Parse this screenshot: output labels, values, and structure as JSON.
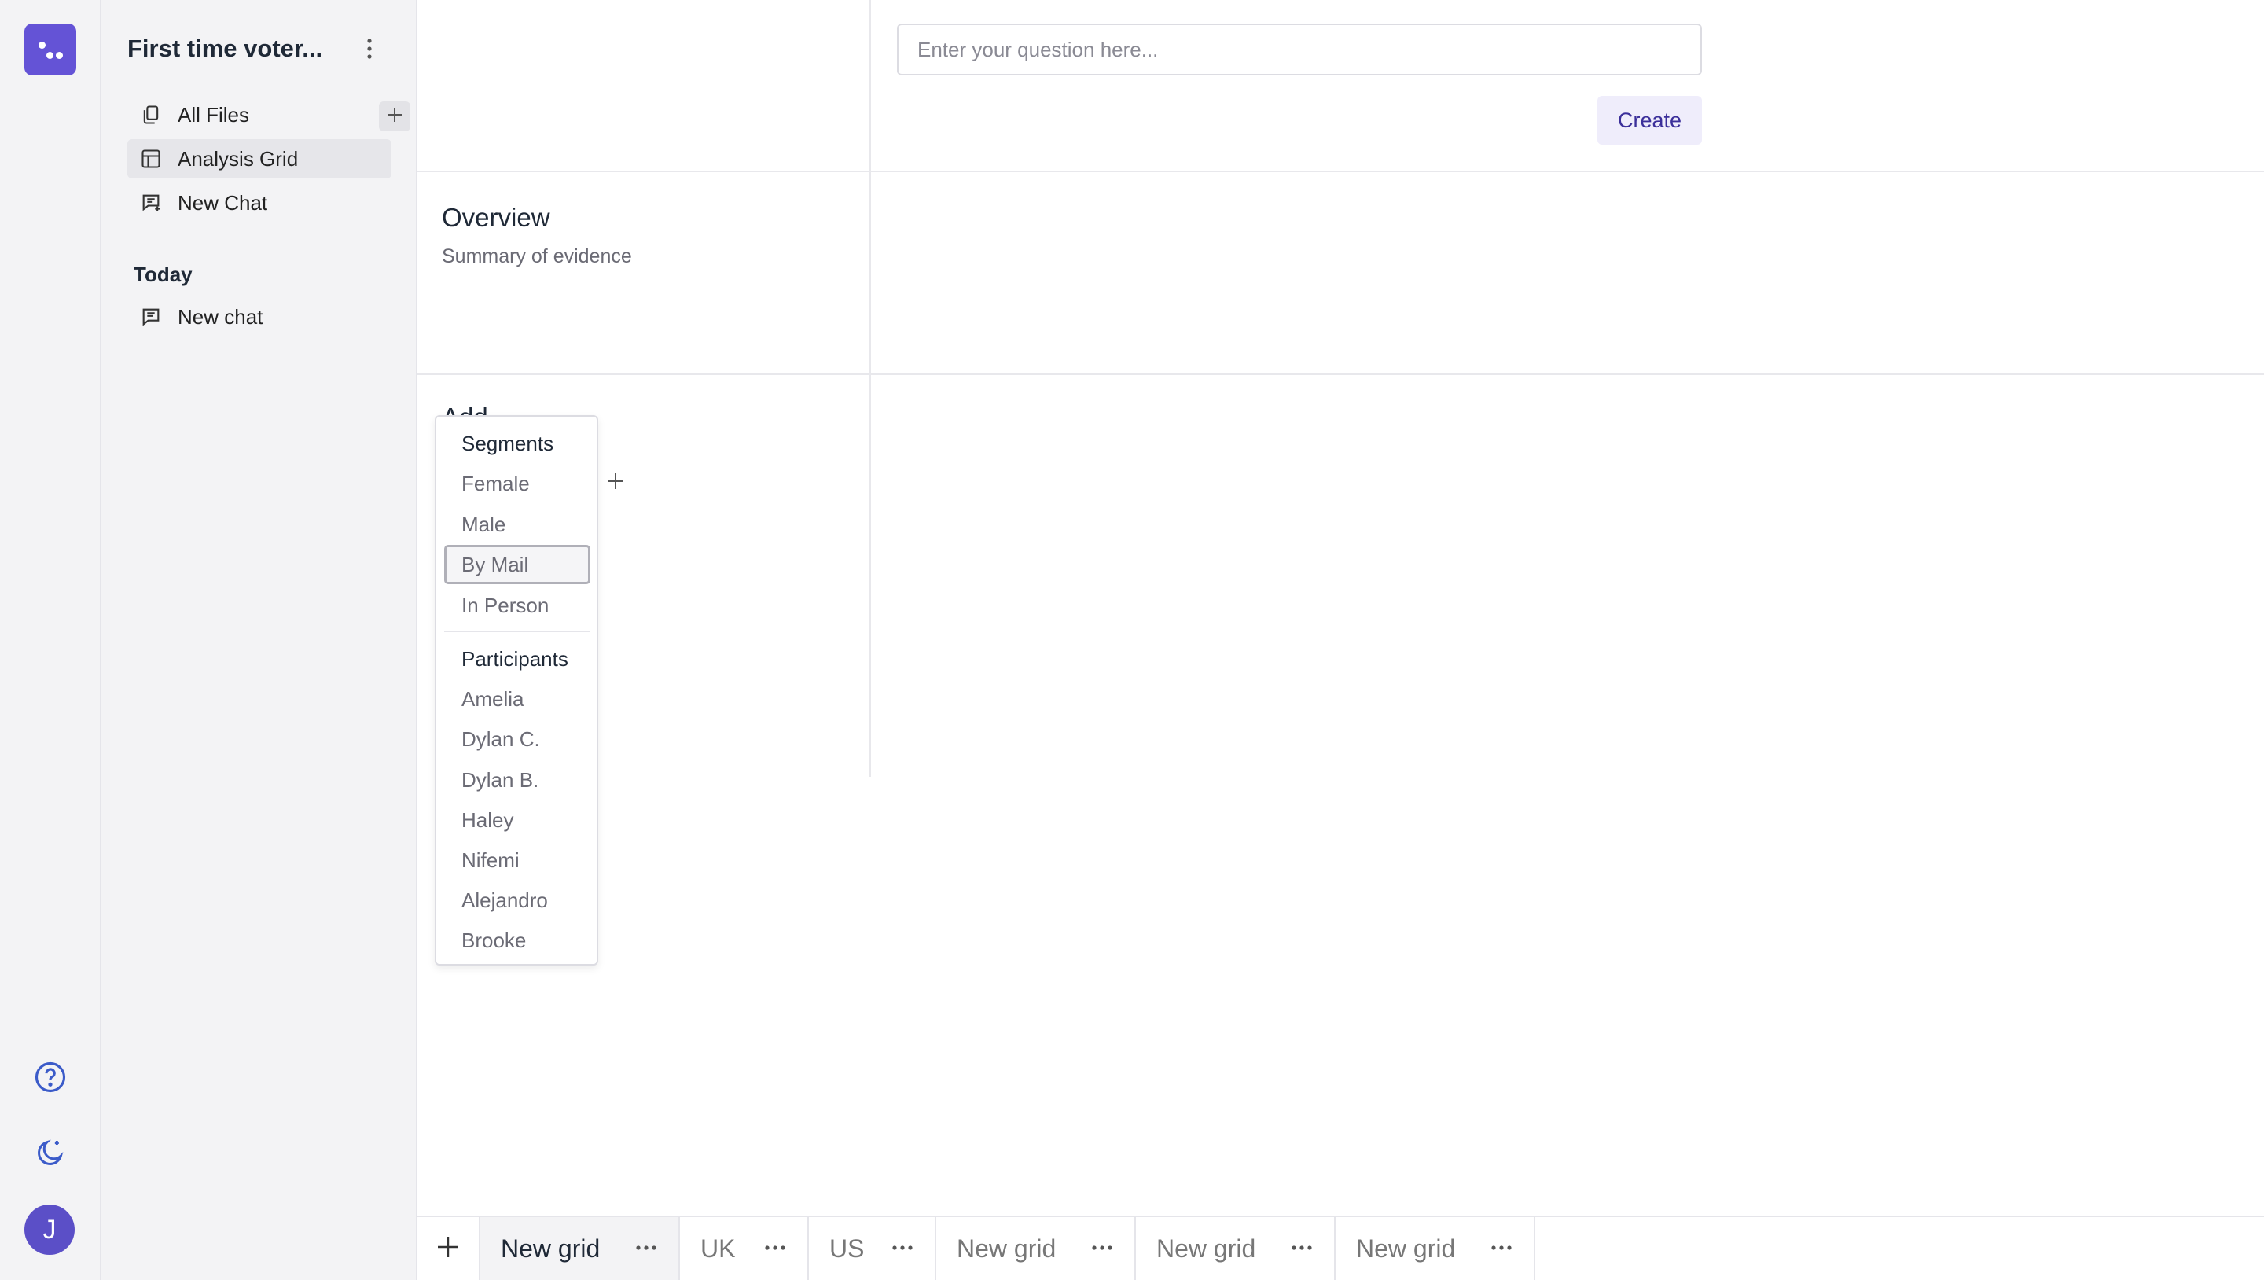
{
  "rail": {
    "avatar_initial": "J"
  },
  "sidebar": {
    "project_title": "First time voter...",
    "nav": [
      {
        "label": "All Files"
      },
      {
        "label": "Analysis Grid"
      },
      {
        "label": "New Chat"
      }
    ],
    "section_today": "Today",
    "chats": [
      {
        "label": "New chat"
      }
    ]
  },
  "grid": {
    "question_placeholder": "Enter your question here...",
    "create_label": "Create",
    "overview_title": "Overview",
    "overview_subtitle": "Summary of evidence",
    "obscured_row_label": "Add"
  },
  "dropdown": {
    "segments_header": "Segments",
    "segments": [
      "Female",
      "Male",
      "By Mail",
      "In Person"
    ],
    "participants_header": "Participants",
    "participants": [
      "Amelia",
      "Dylan C.",
      "Dylan B.",
      "Haley",
      "Nifemi",
      "Alejandro",
      "Brooke"
    ],
    "selected": "By Mail"
  },
  "tabs": [
    {
      "label": "New grid",
      "active": true
    },
    {
      "label": "UK"
    },
    {
      "label": "US"
    },
    {
      "label": "New grid"
    },
    {
      "label": "New grid"
    },
    {
      "label": "New grid"
    }
  ],
  "colors": {
    "brand": "#6453d6",
    "accent_text": "#3b2f9a",
    "accent_bg": "#efedfb"
  }
}
